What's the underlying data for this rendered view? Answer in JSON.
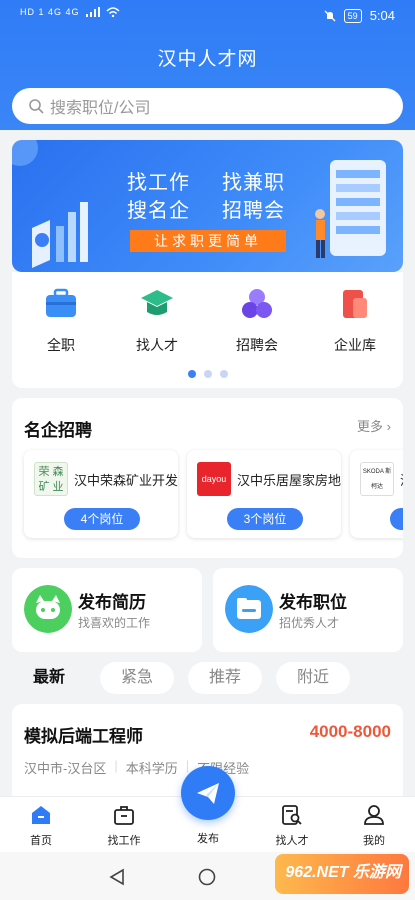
{
  "status_bar": {
    "left": "HD 1 4G 4G",
    "mute_icon": "mute-icon",
    "battery": "59",
    "time": "5:04"
  },
  "app": {
    "title": "汉中人才网"
  },
  "search": {
    "placeholder": "搜索职位/公司"
  },
  "banner": {
    "line1_a": "找工作",
    "line1_b": "找兼职",
    "line2_a": "搜名企",
    "line2_b": "招聘会",
    "cta": "让求职更简单"
  },
  "nav": {
    "items": [
      {
        "label": "全职",
        "icon": "briefcase-icon",
        "color": "#3a8ff6"
      },
      {
        "label": "找人才",
        "icon": "graduation-cap-icon",
        "color": "#2dbd8a"
      },
      {
        "label": "招聘会",
        "icon": "circles-icon",
        "color": "#7a5af5"
      },
      {
        "label": "企业库",
        "icon": "building-icon",
        "color": "#f0504a"
      }
    ]
  },
  "famous_companies": {
    "title": "名企招聘",
    "more": "更多",
    "items": [
      {
        "name": "汉中荣森矿业开发",
        "logo_text": "荣 森 矿 业",
        "jobs": "4个岗位"
      },
      {
        "name": "汉中乐居屋家房地",
        "logo_text": "dayou",
        "jobs": "3个岗位"
      },
      {
        "name": "汉",
        "logo_text": "SKODA 斯柯达",
        "jobs": ""
      }
    ]
  },
  "actions": [
    {
      "title": "发布简历",
      "sub": "找喜欢的工作",
      "icon": "resume-face-icon",
      "color": "#4ccf5f"
    },
    {
      "title": "发布职位",
      "sub": "招优秀人才",
      "icon": "folder-icon",
      "color": "#3aa1f7"
    }
  ],
  "filter_tabs": [
    {
      "label": "最新",
      "active": true
    },
    {
      "label": "紧急",
      "active": false
    },
    {
      "label": "推荐",
      "active": false
    },
    {
      "label": "附近",
      "active": false
    }
  ],
  "job": {
    "title": "模拟后端工程师",
    "salary": "4000-8000",
    "location": "汉中市-汉台区",
    "education": "本科学历",
    "experience": "不限经验"
  },
  "tabbar": {
    "items": [
      {
        "label": "首页",
        "icon": "home-icon"
      },
      {
        "label": "找工作",
        "icon": "briefcase-outline-icon"
      },
      {
        "label": "发布",
        "icon": "paper-plane-icon"
      },
      {
        "label": "找人才",
        "icon": "person-search-icon"
      },
      {
        "label": "我的",
        "icon": "user-icon"
      }
    ]
  },
  "watermark": "962.NET 乐游网"
}
